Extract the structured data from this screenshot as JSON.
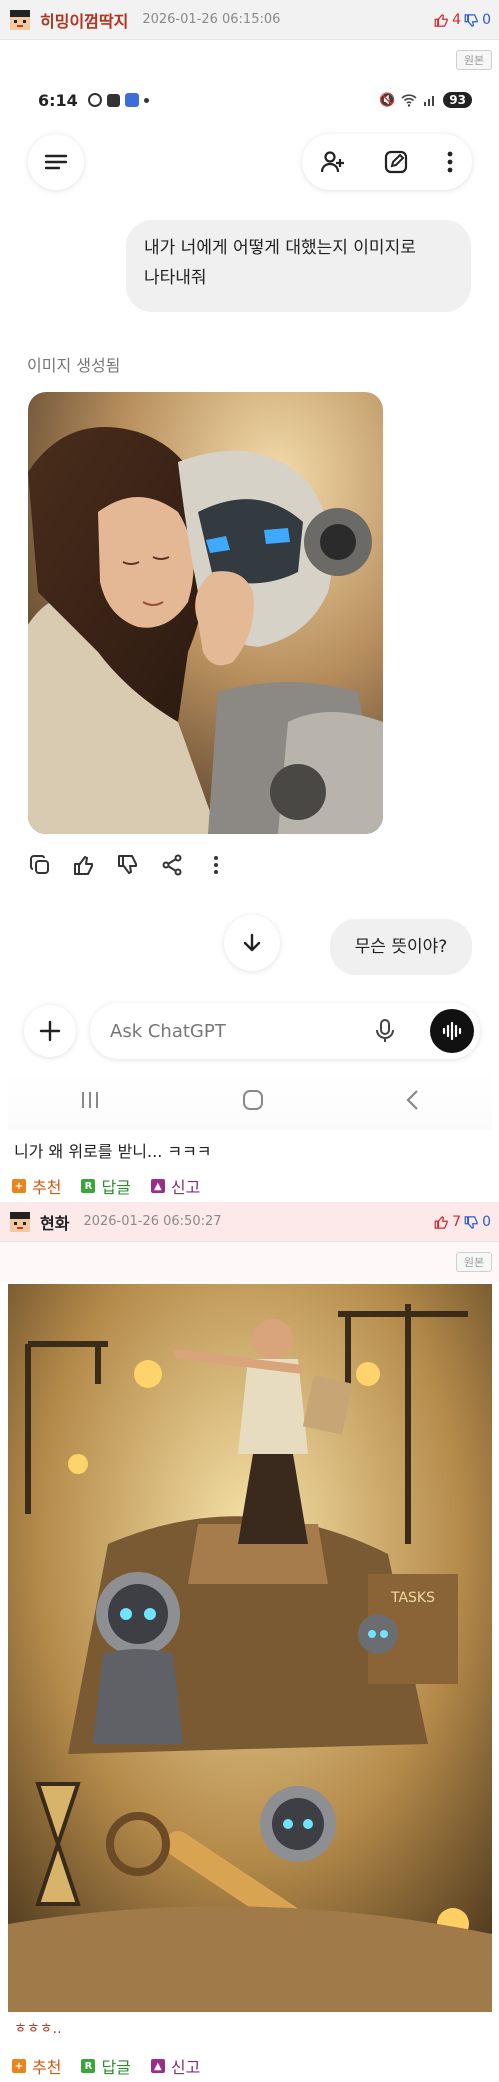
{
  "post1": {
    "nickname": "히밍이껌딱지",
    "timestamp": "2026-01-26 06:15:06",
    "upvotes": "4",
    "downvotes": "0",
    "original_badge": "원본",
    "comment": "니가 왜 위로를 받니... ㅋㅋㅋ"
  },
  "phone": {
    "time": "6:14",
    "battery": "93",
    "user_message": [
      "내가 너에게 어떻게 대했는지 이미지로",
      "나타내줘"
    ],
    "generated_label": "이미지 생성됨",
    "reply_question": "무슨 뜻이야?",
    "input_placeholder": "Ask ChatGPT"
  },
  "actions": {
    "recommend": "추천",
    "reply": "답글",
    "report": "신고"
  },
  "post2": {
    "nickname": "현화",
    "timestamp": "2026-01-26 06:50:27",
    "upvotes": "7",
    "downvotes": "0",
    "original_badge": "원본",
    "comment": "ㅎㅎㅎ..",
    "sign_text": "TASKS"
  },
  "colors": {
    "upvote": "#d6262b",
    "downvote": "#2a5ad7",
    "nick_red": "#b0341d",
    "pink_bg": "#fde9ea"
  }
}
